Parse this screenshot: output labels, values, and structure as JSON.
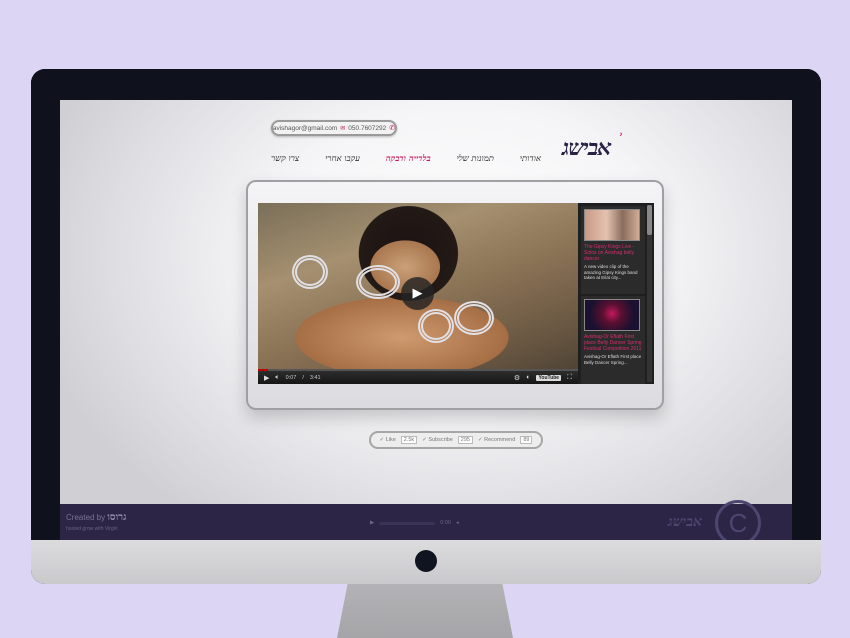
{
  "site": {
    "logo_text": "אבישג",
    "contact": {
      "email": "avishagor@gmail.com",
      "phone": "050.7607292",
      "mail_icon": "envelope-icon",
      "phone_icon": "phone-icon"
    },
    "nav": [
      {
        "label": "אודותי"
      },
      {
        "label": "תמונות שלי"
      },
      {
        "label": "בלדייה ודבקה"
      },
      {
        "label": "עקבו אחרי"
      },
      {
        "label": "צרו קשר"
      }
    ],
    "nav_active_index": 2,
    "accent_color": "#c2185b"
  },
  "video": {
    "current_time": "0:07",
    "duration": "3:41",
    "progress_fraction": 0.03,
    "youtube_badge": "YouTube",
    "playlist": [
      {
        "title": "The Gipsy Kings Live - Solos on Avishag belly dancer",
        "desc": "A new video clip of the amazing Gipsy Kings band taken at Eilat city..."
      },
      {
        "title": "Avishag-Or Eflath First place Belly Dancer Spring Festival Competition 2011",
        "desc": "Avishag-Or Eflath First place Belly Dancer Spring..."
      }
    ]
  },
  "social": {
    "like_label": "Like",
    "like_count": "2.5k",
    "subscribe_label": "Subscribe",
    "subscribe_count": "295",
    "recommend_label": "Recommend",
    "recommend_count": "89"
  },
  "footer": {
    "created_by": "Created by",
    "created_by_brand": "גרוסו",
    "hosted_text": "hosted grow with Virgin",
    "audio_time": "0:00",
    "logo_text": "אבישג",
    "copyright_symbol": "C"
  }
}
